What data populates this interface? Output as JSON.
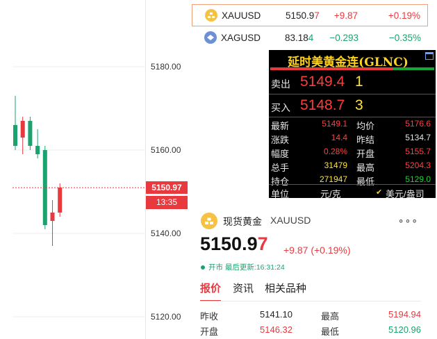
{
  "chart": {
    "y_ticks": [
      "5180.00",
      "5160.00",
      "5140.00",
      "5120.00"
    ],
    "current_price_tag": "5150.97",
    "time_tag": "13:35",
    "colors": {
      "up": "#e8393f",
      "down": "#1aa36e"
    }
  },
  "chart_data": {
    "type": "candlestick",
    "ylim": [
      5115,
      5195
    ],
    "y_ticks": [
      5180,
      5160,
      5140,
      5120
    ],
    "current_price": 5150.97,
    "candles": [
      {
        "open": 5166,
        "close": 5161,
        "high": 5173,
        "low": 5160
      },
      {
        "open": 5163,
        "close": 5167,
        "high": 5168,
        "low": 5159
      },
      {
        "open": 5167,
        "close": 5161,
        "high": 5168,
        "low": 5160
      },
      {
        "open": 5161,
        "close": 5159,
        "high": 5165,
        "low": 5158
      },
      {
        "open": 5160,
        "close": 5142,
        "high": 5161,
        "low": 5141
      },
      {
        "open": 5143,
        "close": 5145,
        "high": 5148,
        "low": 5137
      },
      {
        "open": 5145,
        "close": 5151,
        "high": 5152,
        "low": 5144
      }
    ]
  },
  "quotes": [
    {
      "symbol": "XAUUSD",
      "price_main": "5150.9",
      "price_last": "7",
      "change": "+9.87",
      "pct": "+0.19%",
      "icon": "gold-coin-icon",
      "selected": true
    },
    {
      "symbol": "XAGUSD",
      "price_main": "83.18",
      "price_last": "4",
      "change": "−0.293",
      "pct": "−0.35%",
      "icon": "silver-coin-icon",
      "selected": false
    }
  ],
  "glnc": {
    "title": "延时美黄金连(GLNC)",
    "sell_label": "卖出",
    "sell_price": "5149.4",
    "sell_vol": "1",
    "buy_label": "买入",
    "buy_price": "5148.7",
    "buy_vol": "3",
    "rows": [
      {
        "l1": "最新",
        "v1": "5149.1",
        "l2": "均价",
        "v2": "5176.6"
      },
      {
        "l1": "涨跌",
        "v1": "14.4",
        "l2": "昨结",
        "v2": "5134.7"
      },
      {
        "l1": "幅度",
        "v1": "0.28%",
        "l2": "开盘",
        "v2": "5155.7"
      },
      {
        "l1": "总手",
        "v1": "31479",
        "l2": "最高",
        "v2": "5204.3"
      },
      {
        "l1": "持仓",
        "v1": "271947",
        "l2": "最低",
        "v2": "5129.0"
      }
    ],
    "unit_label": "单位",
    "unit_value": "元/克",
    "unit_alt": "美元/盎司"
  },
  "detail": {
    "name": "现货黄金",
    "symbol": "XAUUSD",
    "more": "∘∘∘",
    "price_main": "5150.9",
    "price_last": "7",
    "change": "+9.87 (+0.19%)",
    "status": "开市 最后更新:16:31:24",
    "tabs": [
      "报价",
      "资讯",
      "相关品种"
    ],
    "rows": [
      {
        "k1": "昨收",
        "v1": "5141.10",
        "k2": "最高",
        "v2": "5194.94",
        "v2_color": "red"
      },
      {
        "k1": "开盘",
        "v1": "5146.32",
        "k2": "最低",
        "v2": "5120.96",
        "v2_color": "green"
      }
    ]
  }
}
